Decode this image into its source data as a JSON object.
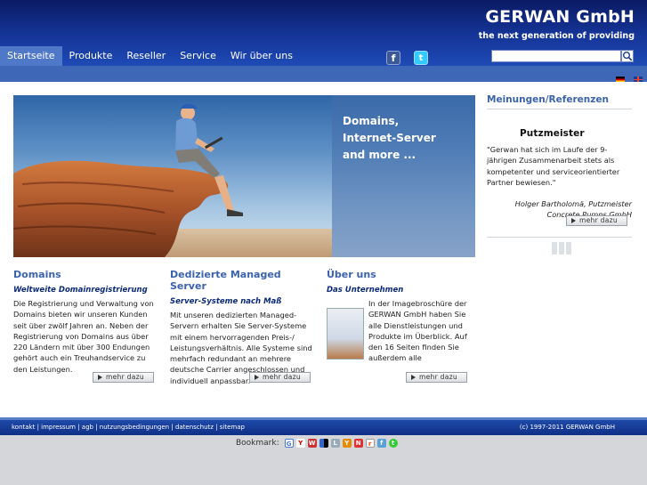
{
  "header": {
    "brand": "GERWAN GmbH",
    "tagline": "the next generation of providing"
  },
  "nav": {
    "items": [
      {
        "label": "Startseite",
        "active": true
      },
      {
        "label": "Produkte"
      },
      {
        "label": "Reseller"
      },
      {
        "label": "Service"
      },
      {
        "label": "Wir über uns"
      }
    ]
  },
  "search": {
    "placeholder": ""
  },
  "hero": {
    "lines": [
      "Domains,",
      "Internet-Server",
      "and more ..."
    ]
  },
  "columns": [
    {
      "title": "Domains",
      "subtitle": "Weltweite Domainregistrierung",
      "text": "Die Registrierung und Verwaltung von Domains bieten wir unseren Kunden seit über zwölf Jahren an. Neben der Registrierung von Domains aus über 220 Ländern mit über 300 Endungen gehört auch ein Treuhandservice zu den Leistungen.",
      "more": "mehr dazu"
    },
    {
      "title": "Dedizierte Managed Server",
      "subtitle": "Server-Systeme nach Maß",
      "text": "Mit unseren dedizierten Managed-Servern erhalten Sie Server-Systeme mit einem hervorragenden Preis-/ Leistungsverhältnis. Alle Systeme sind mehrfach redundant an mehrere deutsche Carrier angeschlossen und individuell anpassbar.",
      "more": "mehr dazu"
    },
    {
      "title": "Über uns",
      "subtitle": "Das Unternehmen",
      "text": "In der Imagebroschüre der GERWAN GmbH haben Sie alle Dienstleistungen und Produkte im Überblick. Auf den 16 Seiten finden Sie außerdem alle Unternehmensinfos.",
      "more": "mehr dazu"
    }
  ],
  "sidebar": {
    "title": "Meinungen/Referenzen",
    "logo": "Putzmeister",
    "quote": "\"Gerwan hat sich im Laufe der 9-jährigen Zusammenarbeit stets als kompetenter und serviceorientierter Partner bewiesen.\"",
    "author_line1": "Holger Bartholomä, Putzmeister",
    "author_line2": "Concrete Pumps GmbH",
    "more": "mehr dazu"
  },
  "footer": {
    "links": [
      "kontakt",
      "impressum",
      "agb",
      "nutzungsbedingungen",
      "datenschutz",
      "sitemap"
    ],
    "copyright": "(c) 1997-2011 GERWAN GmbH"
  },
  "bookmark": {
    "label": "Bookmark:",
    "icons": [
      "google-icon",
      "yahoo-icon",
      "mrwong-icon",
      "delicious-icon",
      "linkarena-icon",
      "yigg-icon",
      "webnews-icon",
      "reddit-icon",
      "folkd-icon",
      "technorati-icon"
    ]
  }
}
